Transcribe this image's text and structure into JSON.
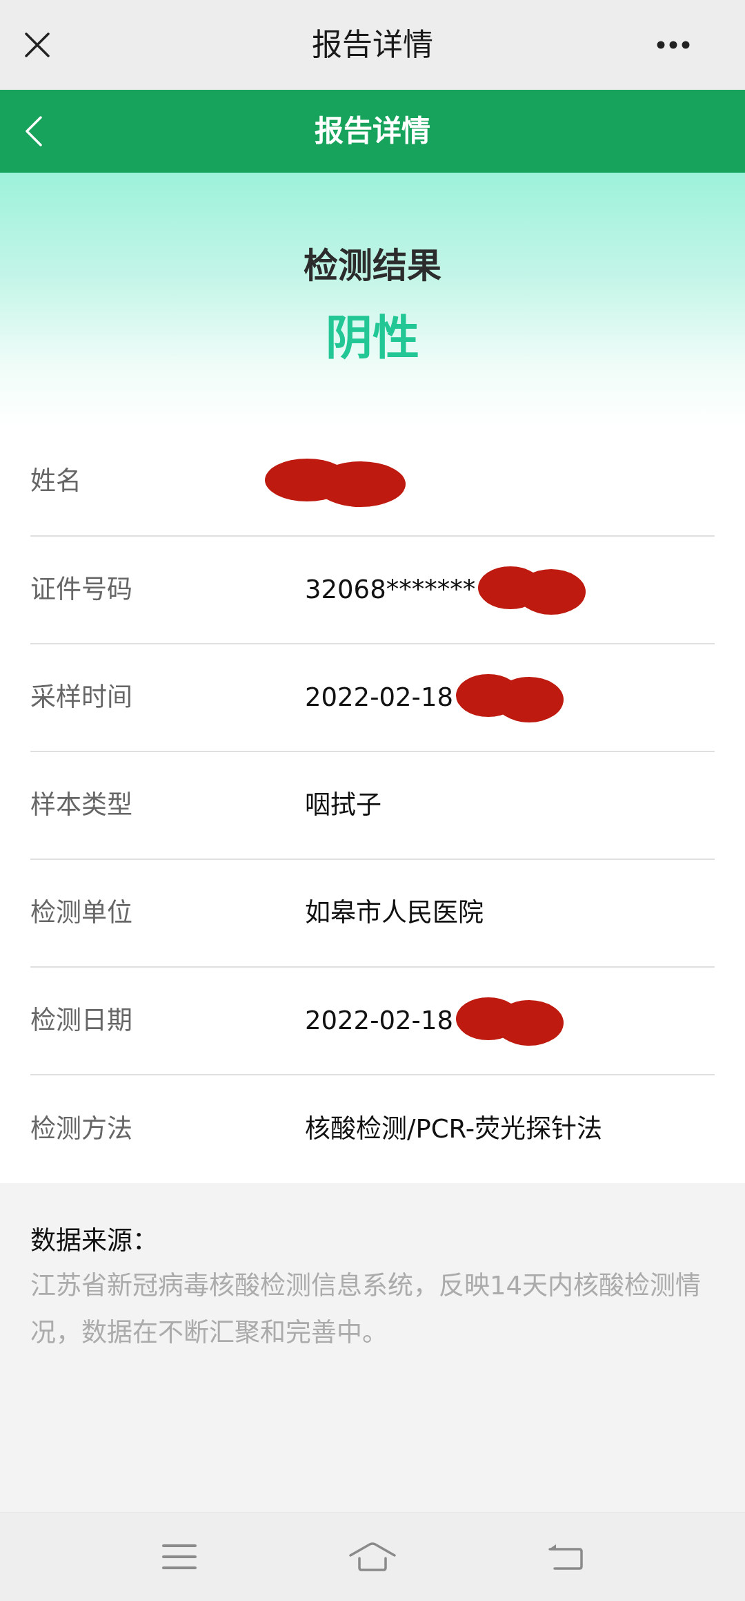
{
  "top_bar": {
    "title": "报告详情"
  },
  "header": {
    "title": "报告详情"
  },
  "result": {
    "heading": "检测结果",
    "value": "阴性"
  },
  "fields": [
    {
      "label": "姓名",
      "redacted": true
    },
    {
      "label": "证件号码",
      "value": "32068*******",
      "redacted": true
    },
    {
      "label": "采样时间",
      "value": "2022-02-18",
      "redacted": true
    },
    {
      "label": "样本类型",
      "value": "咽拭子",
      "redacted": false
    },
    {
      "label": "检测单位",
      "value": "如皋市人民医院",
      "redacted": false
    },
    {
      "label": "检测日期",
      "value": "2022-02-18",
      "redacted": true
    },
    {
      "label": "检测方法",
      "value": "核酸检测/PCR-荧光探针法",
      "redacted": false
    }
  ],
  "source": {
    "title": "数据来源：",
    "text": "江苏省新冠病毒核酸检测信息系统，反映14天内核酸检测情况，数据在不断汇聚和完善中。"
  }
}
